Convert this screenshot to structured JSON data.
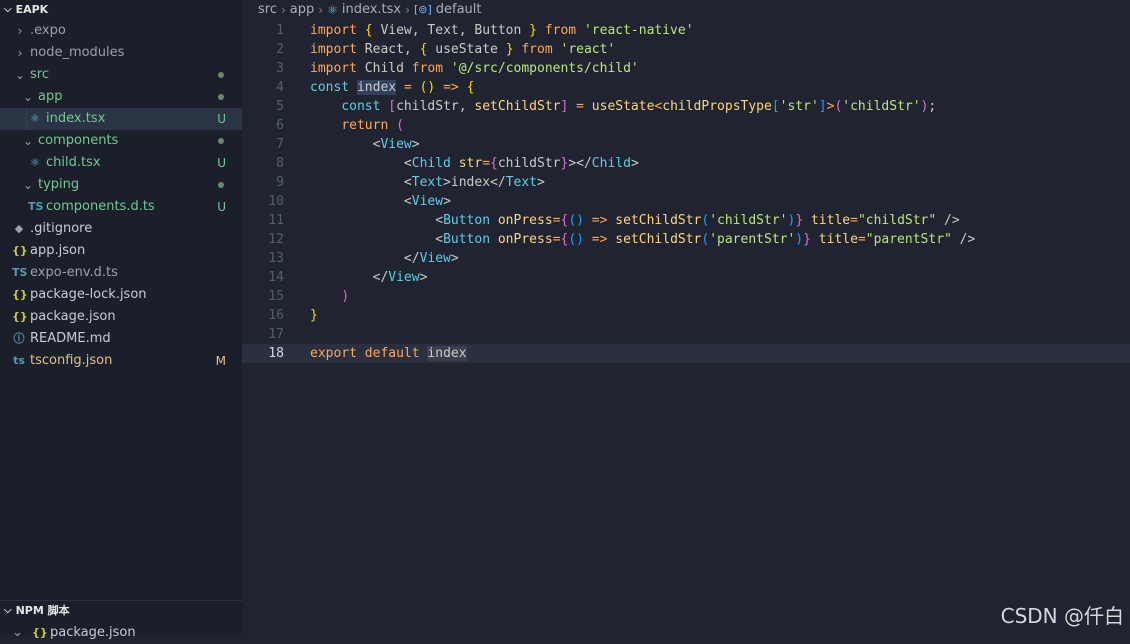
{
  "explorer": {
    "title": "EAPK",
    "items": [
      {
        "label": ".expo",
        "badge": ""
      },
      {
        "label": "node_modules",
        "badge": ""
      },
      {
        "label": "src",
        "badge": ""
      },
      {
        "label": "app",
        "badge": ""
      },
      {
        "label": "index.tsx",
        "badge": "U"
      },
      {
        "label": "components",
        "badge": ""
      },
      {
        "label": "child.tsx",
        "badge": "U"
      },
      {
        "label": "typing",
        "badge": ""
      },
      {
        "label": "components.d.ts",
        "badge": "U"
      },
      {
        "label": ".gitignore",
        "badge": ""
      },
      {
        "label": "app.json",
        "badge": ""
      },
      {
        "label": "expo-env.d.ts",
        "badge": ""
      },
      {
        "label": "package-lock.json",
        "badge": ""
      },
      {
        "label": "package.json",
        "badge": ""
      },
      {
        "label": "README.md",
        "badge": ""
      },
      {
        "label": "tsconfig.json",
        "badge": "M"
      }
    ]
  },
  "npm": {
    "title": "NPM 脚本",
    "item": "package.json"
  },
  "breadcrumb": {
    "parts": [
      "src",
      "app",
      "index.tsx",
      "default"
    ]
  },
  "code": {
    "line_numbers": [
      "1",
      "2",
      "3",
      "4",
      "5",
      "6",
      "7",
      "8",
      "9",
      "10",
      "11",
      "12",
      "13",
      "14",
      "15",
      "16",
      "17",
      "18"
    ],
    "current_line": "18"
  },
  "watermark": "CSDN @仟白",
  "colors": {
    "badge_untracked": "#73c991",
    "badge_modified": "#e2c08d",
    "keyword": "#ffa759",
    "string": "#bae67e",
    "tag": "#5ccfe6"
  }
}
